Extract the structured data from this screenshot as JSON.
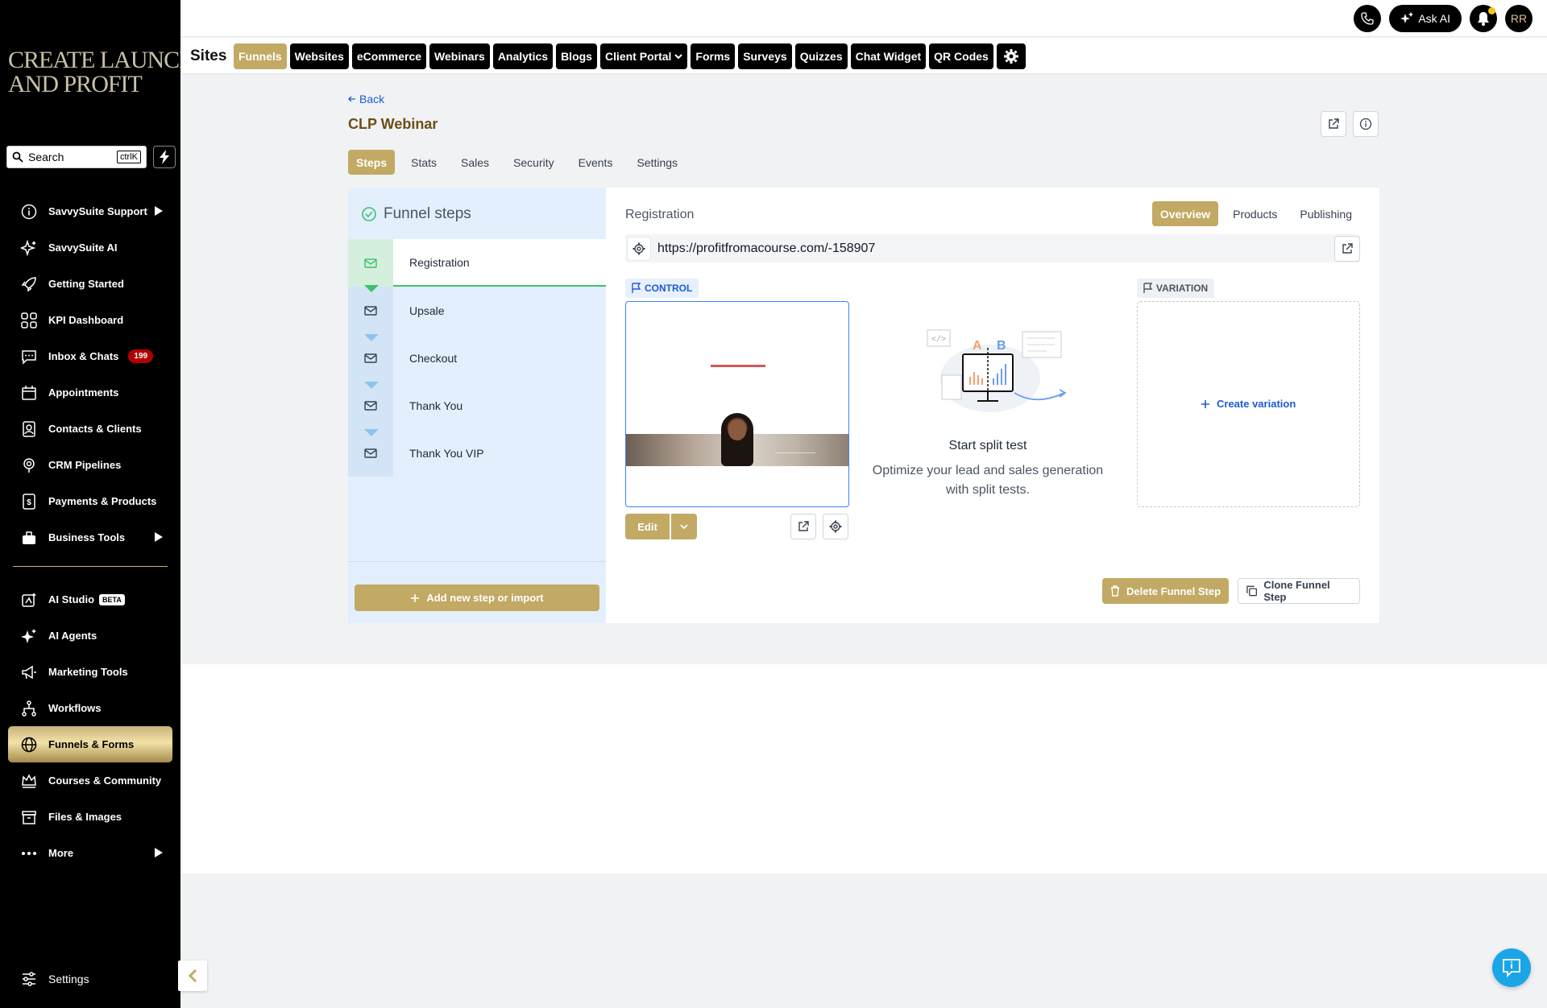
{
  "brand": {
    "logo_line1": "CREATE LAUNCH",
    "logo_line2": "AND PROFIT"
  },
  "search": {
    "placeholder": "Search",
    "shortcut": "ctrlK"
  },
  "sidebar": {
    "items": [
      {
        "label": "SavvySuite Support",
        "icon": "info-icon"
      },
      {
        "label": "SavvySuite AI",
        "icon": "sparkle-icon"
      },
      {
        "label": "Getting Started",
        "icon": "rocket-icon"
      },
      {
        "label": "KPI Dashboard",
        "icon": "grid-icon"
      },
      {
        "label": "Inbox & Chats",
        "icon": "chat-icon",
        "badge": "199"
      },
      {
        "label": "Appointments",
        "icon": "calendar-icon"
      },
      {
        "label": "Contacts & Clients",
        "icon": "contact-icon"
      },
      {
        "label": "CRM Pipelines",
        "icon": "pipeline-icon"
      },
      {
        "label": "Payments & Products",
        "icon": "payments-icon"
      },
      {
        "label": "Business Tools",
        "icon": "toolbox-icon"
      }
    ],
    "items2": [
      {
        "label": "AI Studio",
        "icon": "ai-studio-icon",
        "badge": "BETA"
      },
      {
        "label": "AI Agents",
        "icon": "agents-icon"
      },
      {
        "label": "Marketing Tools",
        "icon": "megaphone-icon"
      },
      {
        "label": "Workflows",
        "icon": "workflow-icon"
      },
      {
        "label": "Funnels & Forms",
        "icon": "globe-icon",
        "active": true
      },
      {
        "label": "Courses & Community",
        "icon": "crown-icon"
      },
      {
        "label": "Files & Images",
        "icon": "archive-icon"
      },
      {
        "label": "More",
        "icon": "dots-icon"
      }
    ],
    "settings_label": "Settings"
  },
  "topbar": {
    "ask_ai_label": "Ask AI",
    "avatar_initials": "RR"
  },
  "sites": {
    "title": "Sites",
    "tabs": [
      "Funnels",
      "Websites",
      "eCommerce",
      "Webinars",
      "Analytics",
      "Blogs",
      "Client Portal",
      "Forms",
      "Surveys",
      "Quizzes",
      "Chat Widget",
      "QR Codes"
    ],
    "active_tab": "Funnels"
  },
  "page": {
    "back_label": "Back",
    "title": "CLP Webinar",
    "tabs": [
      "Steps",
      "Stats",
      "Sales",
      "Security",
      "Events",
      "Settings"
    ],
    "active_tab": "Steps"
  },
  "funnel_steps": {
    "heading": "Funnel steps",
    "steps": [
      "Registration",
      "Upsale",
      "Checkout",
      "Thank You",
      "Thank You VIP"
    ],
    "active_step": "Registration",
    "add_label": "Add new step or import"
  },
  "detail": {
    "title": "Registration",
    "tabs": [
      "Overview",
      "Products",
      "Publishing"
    ],
    "active_tab": "Overview",
    "url": "https://profitfromacourse.com/-158907",
    "control_label": "CONTROL",
    "variation_label": "VARIATION",
    "edit_label": "Edit",
    "split_title": "Start split test",
    "split_desc": "Optimize your lead and sales generation with split tests.",
    "create_variation_label": "Create variation",
    "delete_label": "Delete Funnel Step",
    "clone_label": "Clone Funnel Step",
    "art_letters": {
      "a": "A",
      "b": "B"
    }
  },
  "colors": {
    "gold": "#c2a964",
    "link": "#1d5bd6",
    "success": "#3fbf6a",
    "badge": "#b10000"
  }
}
